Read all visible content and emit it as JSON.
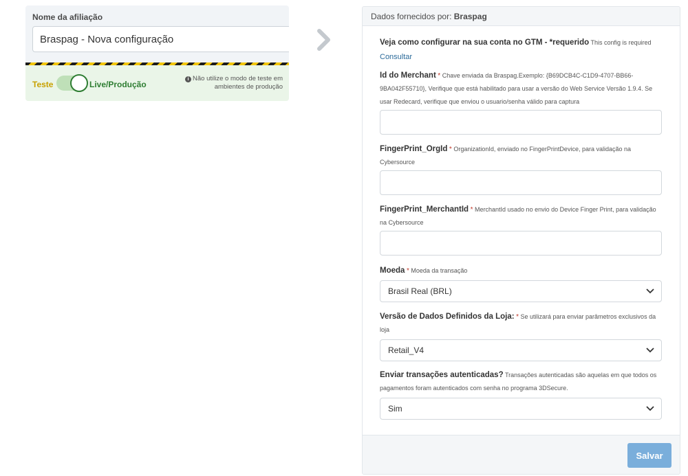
{
  "affiliation": {
    "label": "Nome da afiliação",
    "name_value": "Braspag - Nova configuração",
    "mode": {
      "test_label": "Teste",
      "live_label": "Live/Produção",
      "note": "Não utilize o modo de teste em ambientes de produção",
      "info_icon": "info-circle-icon"
    }
  },
  "panel": {
    "header": {
      "prefix": "Dados fornecidos por:",
      "provider": "Braspag"
    },
    "gtm": {
      "title": "Veja como configurar na sua conta no GTM - *requerido",
      "note": "This config is required",
      "link": "Consultar"
    },
    "fields": [
      {
        "title": "Id do Merchant",
        "required": "*",
        "help": "Chave enviada da Braspag.Exemplo: {B69DCB4C-C1D9-4707-BB66-9BA042F55710}, Verifique que está habilitado para usar a versão do Web Service Versão 1.9.4. Se usar Redecard, verifique que enviou o usuario/senha válido para captura",
        "value": ""
      },
      {
        "title": "FingerPrint_OrgId",
        "required": "*",
        "help": "OrganizationId, enviado no FingerPrintDevice, para validação na Cybersource",
        "value": ""
      },
      {
        "title": "FingerPrint_MerchantId",
        "required": "*",
        "help": "MerchantId usado no envio do Device Finger Print, para validação na Cybersource",
        "value": ""
      }
    ],
    "selects": [
      {
        "title": "Moeda",
        "required": "*",
        "help": "Moeda da transação",
        "value": "Brasil Real (BRL)"
      },
      {
        "title": "Versão de Dados Definidos da Loja:",
        "required": "*",
        "help": "Se utilizará para enviar parâmetros exclusivos da loja",
        "value": "Retail_V4"
      },
      {
        "title": "Enviar transações autenticadas?",
        "required": "",
        "help": "Transações autenticadas são aquelas em que todos os pagamentos foram autenticados com senha no programa 3DSecure.",
        "value": "Sim"
      }
    ],
    "save_label": "Salvar"
  },
  "icons": {
    "arrow": "chevron-right-icon",
    "select": "chevron-down-icon"
  },
  "colors": {
    "test_mode": "#c8a100",
    "live_mode": "#2e7d32",
    "save_button": "#7aaedb",
    "link": "#2b6a9a"
  }
}
